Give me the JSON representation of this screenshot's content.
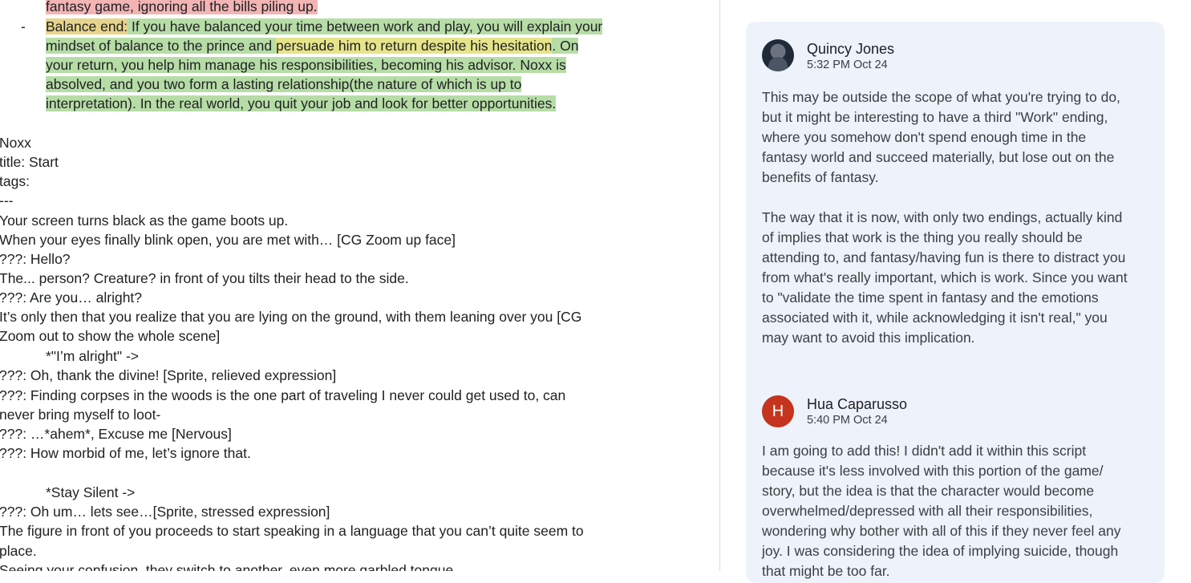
{
  "document": {
    "top_lines": [
      {
        "text": "fantasy game, ignoring all the bills piling up.",
        "highlight": "red"
      }
    ],
    "balance": {
      "bullet": "-",
      "line1_label": "Balance end:",
      "line1_rest": " If you have balanced your time between work and play, you will explain your",
      "line2_a": "mindset of balance to the prince and ",
      "line2_b": "persuade him to return despite his hesitation",
      "line2_c": ". On",
      "line3": "your return, you help him manage his responsibilities, becoming his advisor. Noxx is",
      "line4": "absolved, and you two form a lasting relationship(the nature of which is up to",
      "line5": "interpretation). In the real world, you quit your job and look for better opportunities."
    },
    "script_lines": [
      "Noxx",
      "title: Start",
      "tags:",
      "---",
      "Your screen turns black as the game boots up.",
      "When your eyes finally blink open, you are met with… [CG Zoom up face]",
      "???: Hello?",
      "The... person? Creature? in front of you tilts their head to the side.",
      "???: Are you… alright?",
      "It’s only then that you realize that you are lying on the ground, with them leaning over you [CG",
      "Zoom out to show the whole scene]",
      "*\"I’m alright\" ->",
      "???: Oh, thank the divine! [Sprite, relieved expression]",
      "???: Finding corpses in the woods is the one part of traveling I never could get used to, can",
      "never bring myself to loot-",
      "???: …*ahem*, Excuse me [Nervous]",
      "???: How morbid of me, let’s ignore that.",
      "",
      "*Stay Silent ->",
      "???: Oh um… lets see…[Sprite, stressed expression]",
      "The figure in front of you proceeds to start speaking in a language that you can’t quite seem to",
      "place.",
      "Seeing your confusion, they switch to another, even more garbled tongue."
    ]
  },
  "comments": [
    {
      "author": "Quincy Jones",
      "time": "5:32 PM Oct 24",
      "avatar": "profile-photo",
      "text_p1": "This may be outside the scope of what you're trying to do, but it might be interesting to have a third \"Work\" ending, where you somehow don't spend enough time in the fantasy world and succeed materially, but lose out on the benefits of fantasy.",
      "text_p2": "The way that it is now, with only two endings, actually kind of implies that work is the thing you really should be attending to, and fantasy/having fun is there to distract you from what's really important, which is work. Since you want to \"validate the time spent in fantasy and the emotions associated with it, while acknowledging it isn't real,\" you may want to avoid this implication."
    },
    {
      "author": "Hua Caparusso",
      "time": "5:40 PM Oct 24",
      "avatar_letter": "H",
      "avatar_color": "#c5341c",
      "text": "I am going to add this! I didn't add it within this script because it's less involved with this portion of the game/ story, but the idea is that the character would become overwhelmed/depressed with all their responsibilities, wondering why bother with all of this if they never feel any joy. I was considering the idea of implying suicide, though that might be too far."
    }
  ],
  "colors": {
    "highlight_red": "#f3b4b4",
    "highlight_green": "#b7dda6",
    "highlight_yellow": "#e6e48a",
    "card_bg": "#edf2fb",
    "avatar_red": "#c5341c"
  }
}
